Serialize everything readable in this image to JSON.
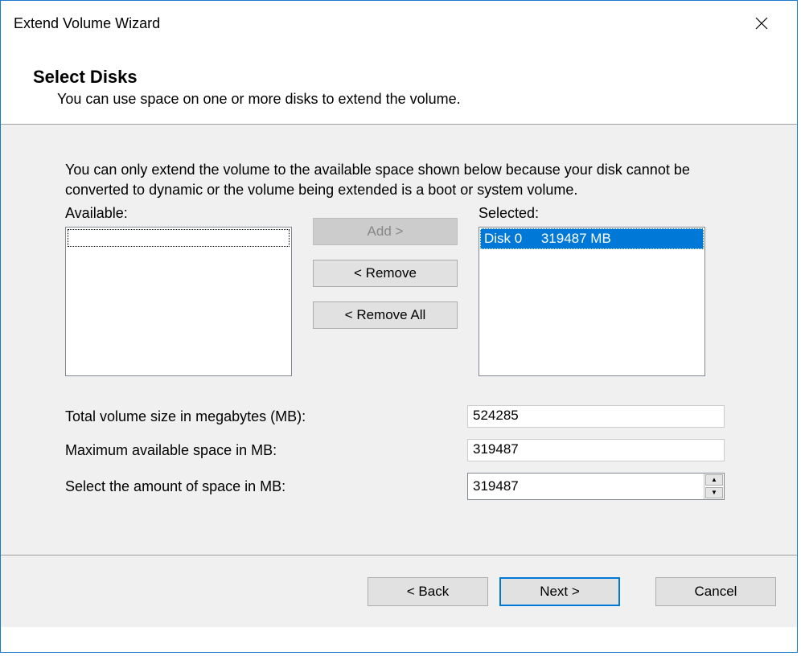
{
  "window": {
    "title": "Extend Volume Wizard"
  },
  "header": {
    "heading": "Select Disks",
    "subtitle": "You can use space on one or more disks to extend the volume."
  },
  "body": {
    "info": "You can only extend the volume to the available space shown below because your disk cannot be converted to dynamic or the volume being extended is a boot or system volume.",
    "available_label": "Available:",
    "selected_label": "Selected:",
    "selected_item": "Disk 0     319487 MB",
    "buttons": {
      "add": "Add >",
      "remove": "< Remove",
      "remove_all": "< Remove All"
    },
    "stats": {
      "total_label": "Total volume size in megabytes (MB):",
      "total_value": "524285",
      "max_label": "Maximum available space in MB:",
      "max_value": "319487",
      "select_label": "Select the amount of space in MB:",
      "select_value": "319487"
    }
  },
  "footer": {
    "back": "< Back",
    "next": "Next >",
    "cancel": "Cancel"
  }
}
